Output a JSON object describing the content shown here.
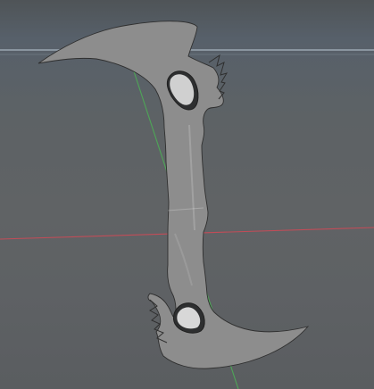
{
  "viewport": {
    "background": "#5e6163",
    "horizon_color": "#8a95a0",
    "grid_x_axis_color": "#c24c58",
    "grid_z_axis_color": "#4ea657"
  },
  "model": {
    "type": "scythe-like 3D mesh",
    "color": "#8d8d8d"
  }
}
